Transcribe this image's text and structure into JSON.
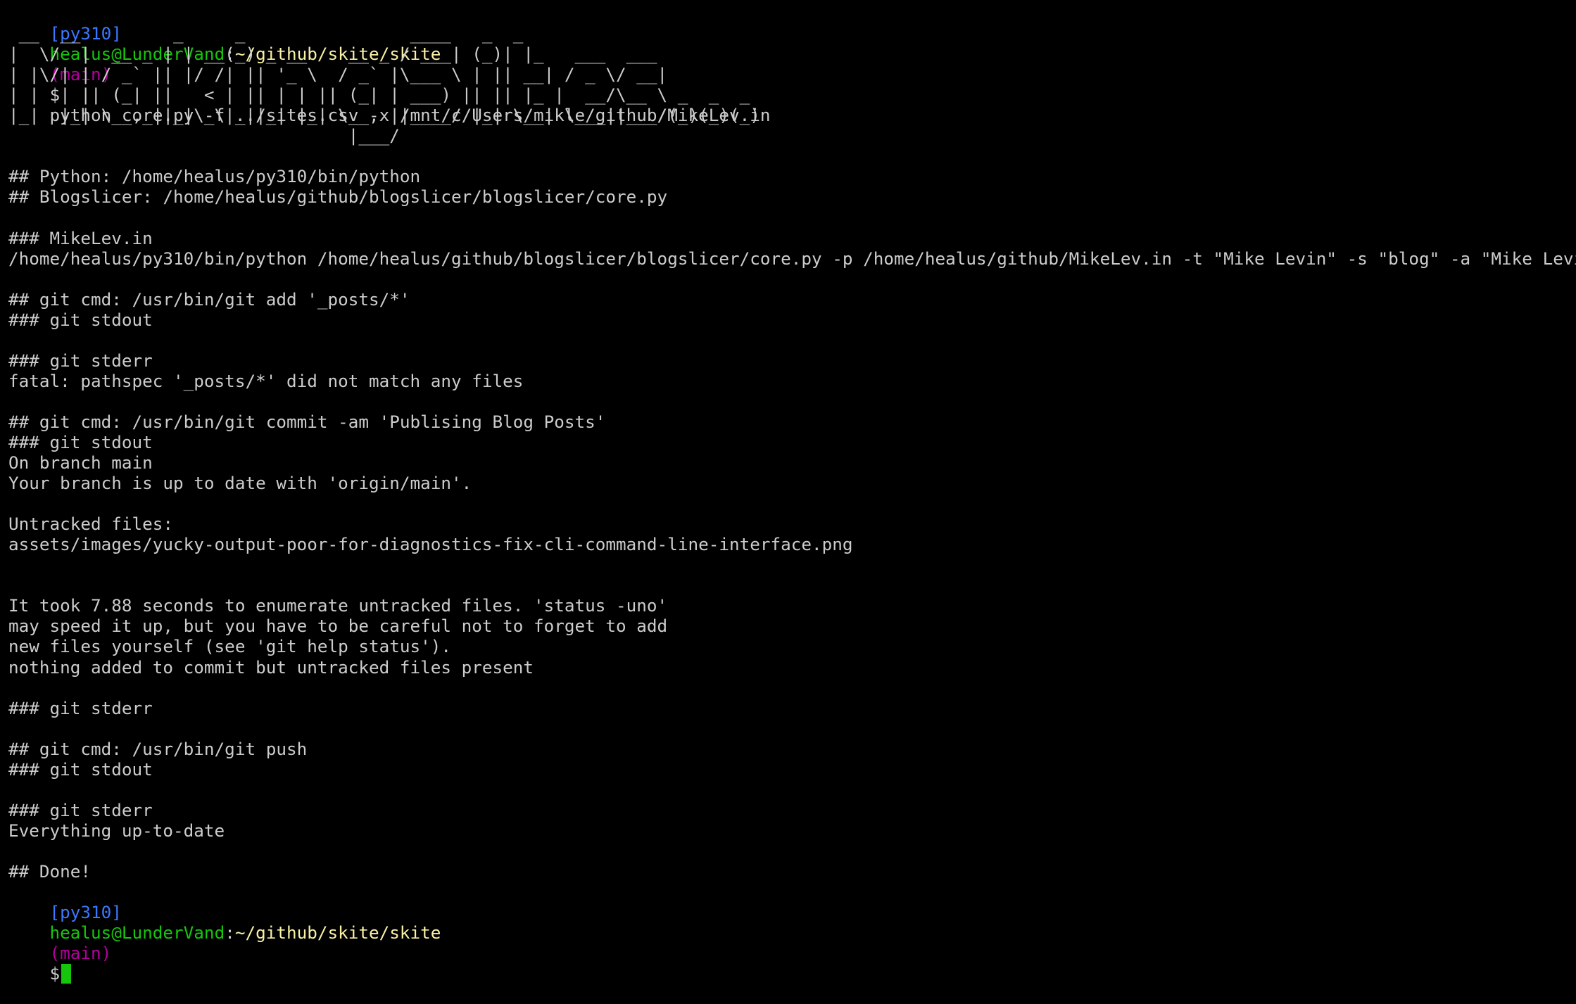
{
  "colors": {
    "background": "#000000",
    "foreground": "#cccccc",
    "env": "#3b78ff",
    "user_host": "#16c60c",
    "path": "#f9f1a5",
    "branch": "#b4009e",
    "cursor": "#16c60c"
  },
  "command_prompt": {
    "env": "[py310]",
    "user_host": "healus@LunderVand",
    "colon": ":",
    "path": "~/github/skite/skite",
    "branch": "(main)",
    "dollar": "$",
    "command": "python core.py -f ../sites.csv -x /mnt/c/Users/mikle/github/MikeLev.in"
  },
  "banner": [
    " __  __         _     _                ____   _  _",
    "|  \\/  |  __ _ | | __(_) _ __    __ _ / ___| (_)| |_   ___  ___",
    "| |\\/| | / _` || |/ /| || '_ \\  / _` |\\___ \\ | || __| / _ \\/ __|",
    "| |  | || (_| ||   < | || | | || (_| | ___) || || |_ |  __/\\__ \\ _  _  _",
    "|_|  |_| \\__,_||_|\\_\\|_||_| |_| \\__, ||____/ |_| \\__| \\___||___/(_)(_)(_)",
    "                                 |___/"
  ],
  "output": [
    "",
    "## Python: /home/healus/py310/bin/python",
    "## Blogslicer: /home/healus/github/blogslicer/blogslicer/core.py",
    "",
    "### MikeLev.in",
    "/home/healus/py310/bin/python /home/healus/github/blogslicer/blogslicer/core.py -p /home/healus/github/MikeLev.in -t \"Mike Levin\" -s \"blog\" -a \"Mike Levin\"",
    "",
    "## git cmd: /usr/bin/git add '_posts/*'",
    "### git stdout",
    "",
    "### git stderr",
    "fatal: pathspec '_posts/*' did not match any files",
    "",
    "## git cmd: /usr/bin/git commit -am 'Publising Blog Posts'",
    "### git stdout",
    "On branch main",
    "Your branch is up to date with 'origin/main'.",
    "",
    "Untracked files:",
    "assets/images/yucky-output-poor-for-diagnostics-fix-cli-command-line-interface.png",
    "",
    "",
    "It took 7.88 seconds to enumerate untracked files. 'status -uno'",
    "may speed it up, but you have to be careful not to forget to add",
    "new files yourself (see 'git help status').",
    "nothing added to commit but untracked files present",
    "",
    "### git stderr",
    "",
    "## git cmd: /usr/bin/git push",
    "### git stdout",
    "",
    "### git stderr",
    "Everything up-to-date",
    "",
    "## Done!"
  ],
  "final_prompt": {
    "env": "[py310]",
    "user_host": "healus@LunderVand",
    "colon": ":",
    "path": "~/github/skite/skite",
    "branch": "(main)",
    "dollar": "$",
    "command": ""
  }
}
